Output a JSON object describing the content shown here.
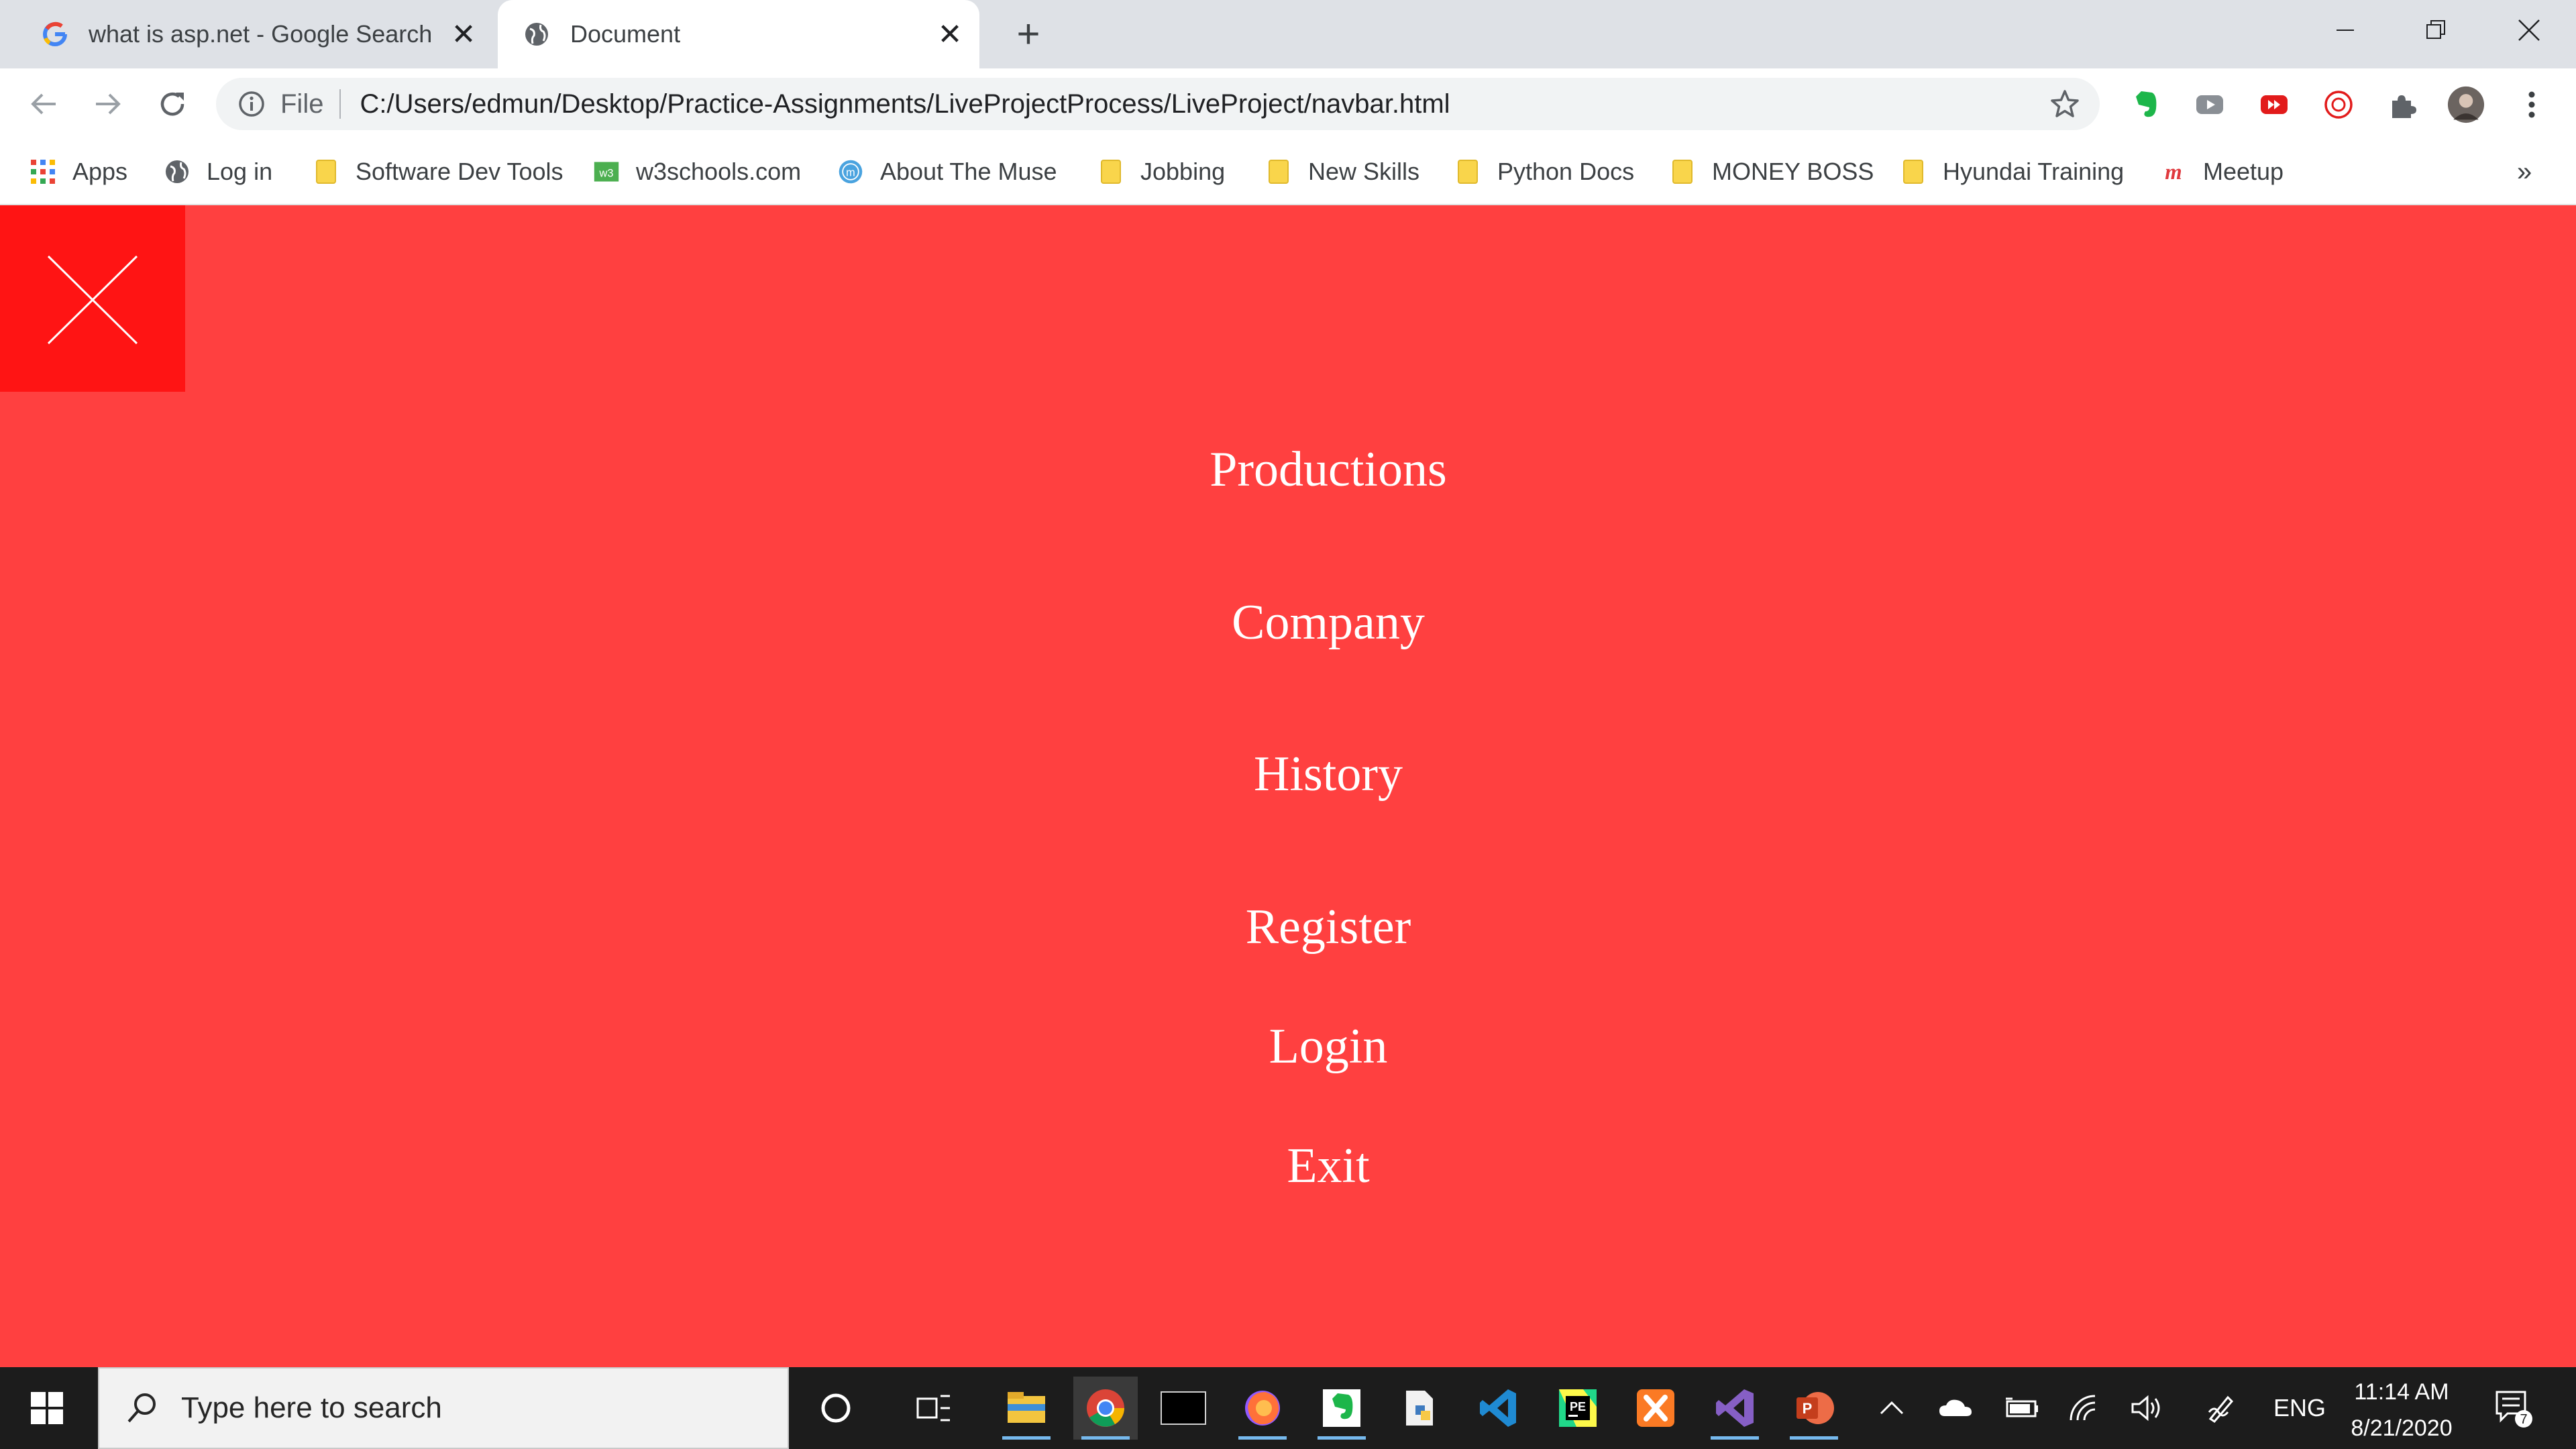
{
  "browser": {
    "tabs": [
      {
        "title": "what is asp.net - Google Search",
        "active": false
      },
      {
        "title": "Document",
        "active": true
      }
    ],
    "address": {
      "scheme_label": "File",
      "url": "C:/Users/edmun/Desktop/Practice-Assignments/LiveProjectProcess/LiveProject/navbar.html"
    },
    "bookmarks": [
      {
        "label": "Apps",
        "icon": "apps-grid-icon"
      },
      {
        "label": "Log in",
        "icon": "globe-icon"
      },
      {
        "label": "Software Dev Tools",
        "icon": "folder-icon"
      },
      {
        "label": "w3schools.com",
        "icon": "w3schools-icon"
      },
      {
        "label": "About The Muse",
        "icon": "muse-icon"
      },
      {
        "label": "Jobbing",
        "icon": "folder-icon"
      },
      {
        "label": "New Skills",
        "icon": "folder-icon"
      },
      {
        "label": "Python Docs",
        "icon": "folder-icon"
      },
      {
        "label": "MONEY BOSS",
        "icon": "folder-icon"
      },
      {
        "label": "Hyundai Training",
        "icon": "folder-icon"
      },
      {
        "label": "Meetup",
        "icon": "meetup-icon"
      }
    ],
    "more_bookmarks": "»"
  },
  "page": {
    "background_color": "#ff4040",
    "toggle_color": "#ff1414",
    "nav_links": [
      "Productions",
      "Company",
      "History",
      "Register",
      "Login",
      "Exit"
    ]
  },
  "taskbar": {
    "search_placeholder": "Type here to search",
    "language": "ENG",
    "time": "11:14 AM",
    "date": "8/21/2020",
    "notifications": "7"
  }
}
